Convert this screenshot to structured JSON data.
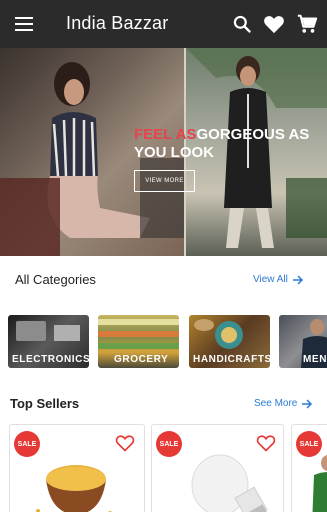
{
  "app": {
    "title": "India Bazzar"
  },
  "banner": {
    "headline_accent": "FEEL AS",
    "headline_rest": "GORGEOUS AS YOU LOOK",
    "cta_label": "VIEW MORE"
  },
  "categories": {
    "title": "All Categories",
    "view_all_label": "View All",
    "items": [
      {
        "label": "ELECTRONICS"
      },
      {
        "label": "GROCERY"
      },
      {
        "label": "HANDICRAFTS"
      },
      {
        "label": "MEN COLLEC"
      }
    ]
  },
  "top_sellers": {
    "title": "Top Sellers",
    "see_more_label": "See More",
    "items": [
      {
        "badge": "SALE"
      },
      {
        "badge": "SALE"
      },
      {
        "badge": "SALE"
      }
    ]
  },
  "colors": {
    "appbar": "#2b2b2b",
    "link": "#2a7bd1",
    "sale_badge": "#e53935",
    "banner_accent": "#e8434c"
  }
}
